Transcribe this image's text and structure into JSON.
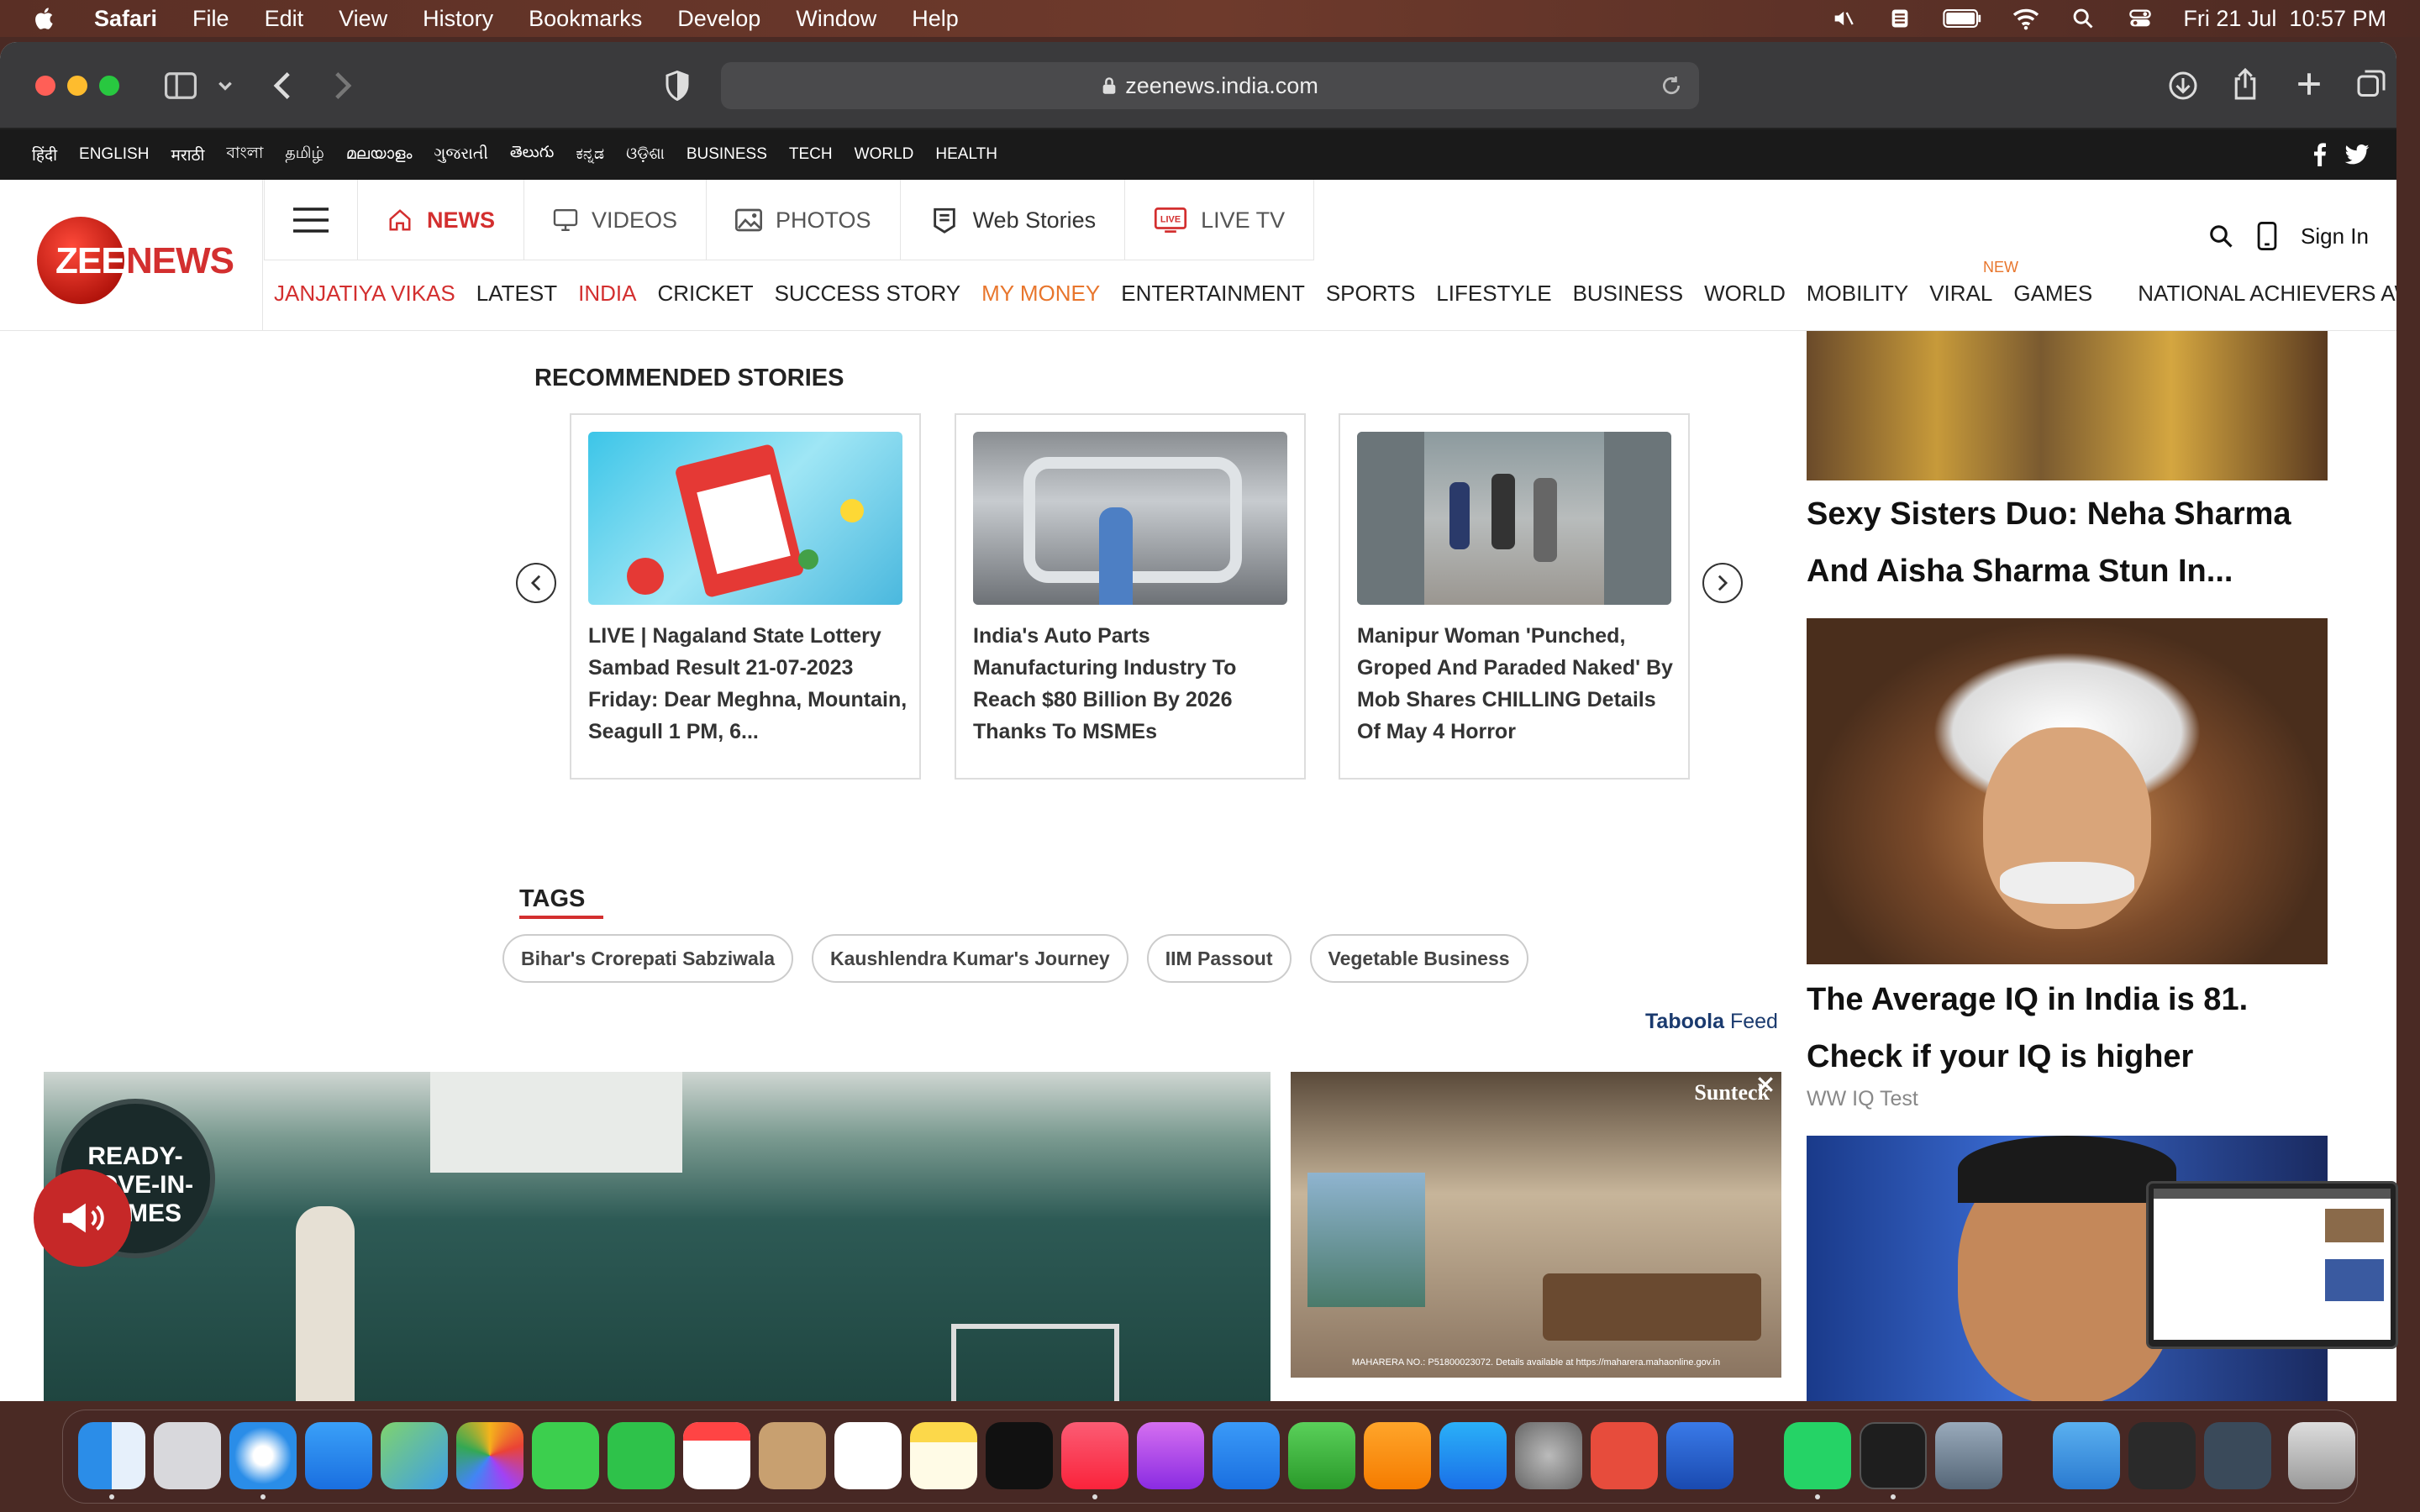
{
  "menubar": {
    "app_name": "Safari",
    "items": [
      "File",
      "Edit",
      "View",
      "History",
      "Bookmarks",
      "Develop",
      "Window",
      "Help"
    ],
    "datetime": "Fri 21 Jul  10:57 PM"
  },
  "browser": {
    "url": "zeenews.india.com"
  },
  "langbar": {
    "items": [
      "हिंदी",
      "ENGLISH",
      "मराठी",
      "বাংলা",
      "தமிழ்",
      "മലയാളം",
      "ગુજરાતી",
      "తెలుగు",
      "ಕನ್ನಡ",
      "ଓଡ଼ିଶା",
      "BUSINESS",
      "TECH",
      "WORLD",
      "HEALTH"
    ]
  },
  "header": {
    "logo_text": "ZEENEWS",
    "nav_top": {
      "news": "NEWS",
      "videos": "VIDEOS",
      "photos": "PHOTOS",
      "web_stories": "Web Stories",
      "live_tv": "LIVE TV"
    },
    "sign_in": "Sign In",
    "nav_bottom": [
      "JANJATIYA VIKAS",
      "LATEST",
      "INDIA",
      "CRICKET",
      "SUCCESS STORY",
      "MY MONEY",
      "ENTERTAINMENT",
      "SPORTS",
      "LIFESTYLE",
      "BUSINESS",
      "WORLD",
      "MOBILITY",
      "VIRAL",
      "GAMES",
      "NATIONAL ACHIEVERS AWARD"
    ],
    "new_badge": "NEW",
    "colors": {
      "brand_red": "#d32f2f",
      "accent_orange": "#e8762d"
    }
  },
  "recommended": {
    "title": "RECOMMENDED STORIES",
    "stories": [
      {
        "text": "LIVE | Nagaland State Lottery Sambad Result 21-07-2023 Friday: Dear Meghna, Mountain, Seagull 1 PM, 6..."
      },
      {
        "text": "India's Auto Parts Manufacturing Industry To Reach $80 Billion By 2026 Thanks To MSMEs"
      },
      {
        "text": "Manipur Woman 'Punched, Groped And Paraded Naked' By Mob Shares CHILLING Details Of May 4 Horror"
      }
    ]
  },
  "tags": {
    "title": "TAGS",
    "items": [
      "Bihar's Crorepati Sabziwala",
      "Kaushlendra Kumar's Journey",
      "IIM Passout",
      "Vegetable Business"
    ]
  },
  "taboola": {
    "label": "Taboola",
    "feed": "Feed"
  },
  "sidebar": {
    "story1_title": "Sexy Sisters Duo: Neha Sharma And Aisha Sharma Stun In...",
    "story2_title": "The Average IQ in India is 81. Check if your IQ is higher",
    "story2_source": "WW IQ Test"
  },
  "ads": {
    "ad1_text": "READY-\nMOVE-IN-\nHOMES",
    "ad2_brand": "Sunteck",
    "ad2_caption": "MAHARERA NO.: P51800023072. Details available at https://maharera.mahaonline.gov.in"
  }
}
